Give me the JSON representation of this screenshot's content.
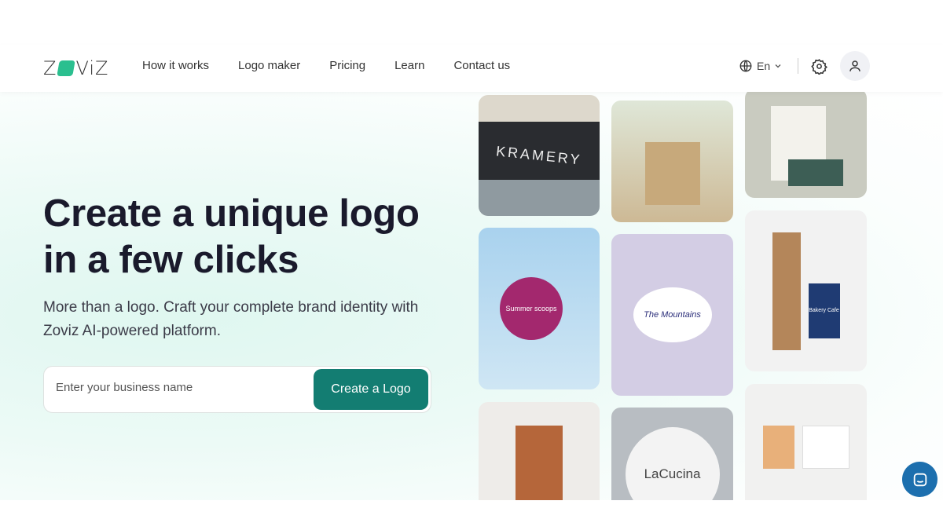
{
  "brand": {
    "name": "ZOVIZ",
    "accent": "#2bbf8f",
    "primary": "#137d72"
  },
  "nav": {
    "items": [
      {
        "label": "How it works"
      },
      {
        "label": "Logo maker"
      },
      {
        "label": "Pricing"
      },
      {
        "label": "Learn"
      },
      {
        "label": "Contact us"
      }
    ]
  },
  "header_right": {
    "language": "En",
    "globe_icon": "globe-icon",
    "settings_icon": "gear-icon",
    "account_icon": "user-icon"
  },
  "hero": {
    "title": "Create a unique logo in a few clicks",
    "subtitle": "More than a logo. Craft your complete brand identity with Zoviz AI-powered platform.",
    "input_placeholder": "Enter your business name",
    "cta_label": "Create a Logo"
  },
  "gallery": {
    "tiles": [
      {
        "text": "KRAMERY"
      },
      {
        "text": ""
      },
      {
        "text": ""
      },
      {
        "text": "Summer scoops"
      },
      {
        "text": "The Mountains"
      },
      {
        "text": "Bakery Cafe"
      },
      {
        "text": ""
      },
      {
        "text": "LaCucina"
      },
      {
        "text": ""
      }
    ]
  },
  "chat_icon": "chat-icon"
}
